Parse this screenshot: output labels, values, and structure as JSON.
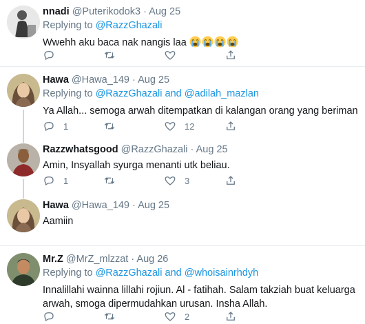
{
  "tweets": [
    {
      "name": "nnadi",
      "handle": "@Puterikodok3",
      "dot": "·",
      "time": "Aug 25",
      "replying_prefix": "Replying to ",
      "replying_to": [
        "@RazzGhazali"
      ],
      "text": "Wwehh aku baca nak nangis laa",
      "emoji": [
        "loudly-crying-face",
        "loudly-crying-face",
        "loudly-crying-face",
        "loudly-crying-face"
      ],
      "replies": "",
      "retweets": "",
      "likes": ""
    },
    {
      "name": "Hawa",
      "handle": "@Hawa_149",
      "dot": "·",
      "time": "Aug 25",
      "replying_prefix": "Replying to ",
      "replying_to": [
        "@RazzGhazali",
        "@adilah_mazlan"
      ],
      "and_word": " and ",
      "text": "Ya Allah... semoga arwah ditempatkan di kalangan orang yang beriman",
      "replies": "1",
      "retweets": "",
      "likes": "12"
    },
    {
      "name": "Razzwhatsgood",
      "handle": "@RazzGhazali",
      "dot": "·",
      "time": "Aug 25",
      "text": "Amin, Insyallah syurga menanti utk beliau.",
      "replies": "1",
      "retweets": "",
      "likes": "3"
    },
    {
      "name": "Hawa",
      "handle": "@Hawa_149",
      "dot": "·",
      "time": "Aug 25",
      "text": "Aamiin",
      "replies": "",
      "retweets": "",
      "likes": ""
    },
    {
      "name": "Mr.Z",
      "handle": "@MrZ_mlzzat",
      "dot": "·",
      "time": "Aug 26",
      "replying_prefix": "Replying to ",
      "replying_to": [
        "@RazzGhazali",
        "@whoisainrhdyh"
      ],
      "and_word": " and ",
      "text": "Innalillahi wainna lillahi rojiun. Al - fatihah. Salam takziah buat keluarga arwah, smoga dipermudahkan urusan. Insha Allah.",
      "replies": "",
      "retweets": "",
      "likes": "2"
    }
  ],
  "colors": {
    "link": "#1b95e0",
    "muted": "#657786",
    "text": "#14171a",
    "thread_line": "#ccd6dd",
    "divider": "#e6ecf0"
  }
}
